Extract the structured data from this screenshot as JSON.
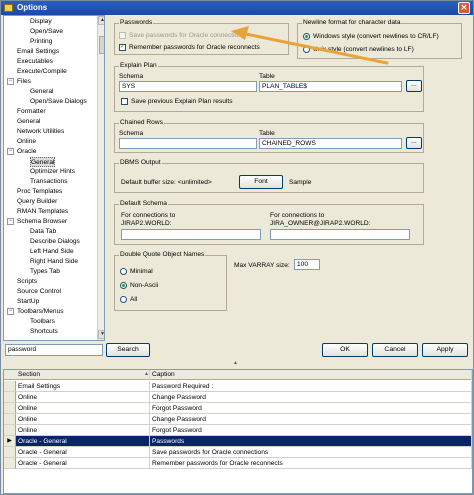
{
  "window": {
    "title": "Options",
    "close_glyph": "✕"
  },
  "tree": {
    "items": [
      {
        "label": "Display",
        "level": 2
      },
      {
        "label": "Open/Save",
        "level": 2
      },
      {
        "label": "Printing",
        "level": 2
      },
      {
        "label": "Email Settings",
        "level": 1
      },
      {
        "label": "Executables",
        "level": 1
      },
      {
        "label": "Execute/Compile",
        "level": 1
      },
      {
        "label": "Files",
        "level": 1,
        "expander": "−"
      },
      {
        "label": "General",
        "level": 2
      },
      {
        "label": "Open/Save Dialogs",
        "level": 2
      },
      {
        "label": "Formatter",
        "level": 1
      },
      {
        "label": "General",
        "level": 1
      },
      {
        "label": "Network Utilities",
        "level": 1
      },
      {
        "label": "Online",
        "level": 1
      },
      {
        "label": "Oracle",
        "level": 1,
        "expander": "−"
      },
      {
        "label": "General",
        "level": 2,
        "selected": true
      },
      {
        "label": "Optimizer Hints",
        "level": 2
      },
      {
        "label": "Transactions",
        "level": 2
      },
      {
        "label": "Proc Templates",
        "level": 1
      },
      {
        "label": "Query Builder",
        "level": 1
      },
      {
        "label": "RMAN Templates",
        "level": 1
      },
      {
        "label": "Schema Browser",
        "level": 1,
        "expander": "−"
      },
      {
        "label": "Data Tab",
        "level": 2
      },
      {
        "label": "Describe Dialogs",
        "level": 2
      },
      {
        "label": "Left Hand Side",
        "level": 2
      },
      {
        "label": "Right Hand Side",
        "level": 2
      },
      {
        "label": "Types Tab",
        "level": 2
      },
      {
        "label": "Scripts",
        "level": 1
      },
      {
        "label": "Source Control",
        "level": 1
      },
      {
        "label": "StartUp",
        "level": 1
      },
      {
        "label": "Toolbars/Menus",
        "level": 1,
        "expander": "−"
      },
      {
        "label": "Toolbars",
        "level": 2
      },
      {
        "label": "Shortcuts",
        "level": 2
      }
    ],
    "scroll_up": "▲",
    "scroll_down": "▼"
  },
  "passwords": {
    "title": "Passwords",
    "save_label": "Save passwords for Oracle connections",
    "remember_label": "Remember passwords for Oracle reconnects",
    "remember_checked": true
  },
  "newline": {
    "title": "Newline format for character data",
    "windows_label": "Windows style (convert newlines to CR/LF)",
    "unix_label": "Unix style (convert newlines to LF)"
  },
  "explain": {
    "title": "Explain Plan",
    "schema_label": "Schema",
    "schema_value": "SYS",
    "table_label": "Table",
    "table_value": "PLAN_TABLE$",
    "browse": "...",
    "save_prev_label": "Save previous Explain Plan results"
  },
  "chained": {
    "title": "Chained Rows",
    "schema_label": "Schema",
    "schema_value": "",
    "table_label": "Table",
    "table_value": "CHAINED_ROWS",
    "browse": "..."
  },
  "dbms": {
    "title": "DBMS Output",
    "buffer_label": "Default buffer size: <unlimited>",
    "font_button": "Font",
    "sample_label": "Sample"
  },
  "default_schema": {
    "title": "Default Schema",
    "left_label_1": "For connections to",
    "left_label_2": "JIRAP2.WORLD:",
    "right_label_1": "For connections to",
    "right_label_2": "JIRA_OWNER@JIRAP2.WORLD:"
  },
  "quote": {
    "title": "Double Quote Object Names",
    "options": [
      "Minimal",
      "Non-Ascii",
      "All"
    ],
    "selected": "Non-Ascii"
  },
  "varray": {
    "label": "Max VARRAY size:",
    "value": "100"
  },
  "bottom": {
    "search_value": "password",
    "search_button": "Search",
    "ok_button": "OK",
    "cancel_button": "Cancel",
    "apply_button": "Apply",
    "splitter_glyph": "▲"
  },
  "results": {
    "headers": [
      "Section",
      "Caption"
    ],
    "rows": [
      {
        "section": "Email Settings",
        "caption": "Password Required :"
      },
      {
        "section": "Online",
        "caption": "Change Password"
      },
      {
        "section": "Online",
        "caption": "Forgot Password"
      },
      {
        "section": "Online",
        "caption": "Change Password"
      },
      {
        "section": "Online",
        "caption": "Forgot Password"
      },
      {
        "section": "Oracle - General",
        "caption": "Passwords",
        "selected": true
      },
      {
        "section": "Oracle - General",
        "caption": "Save passwords for Oracle connections"
      },
      {
        "section": "Oracle - General",
        "caption": "Remember passwords for Oracle reconnects"
      }
    ],
    "current_row_marker": "▶",
    "sort_glyph": "▲"
  },
  "colors": {
    "annotation_arrow": "#e8a33a",
    "selection": "#0a246a",
    "title_bar": "#2b5fbd"
  }
}
